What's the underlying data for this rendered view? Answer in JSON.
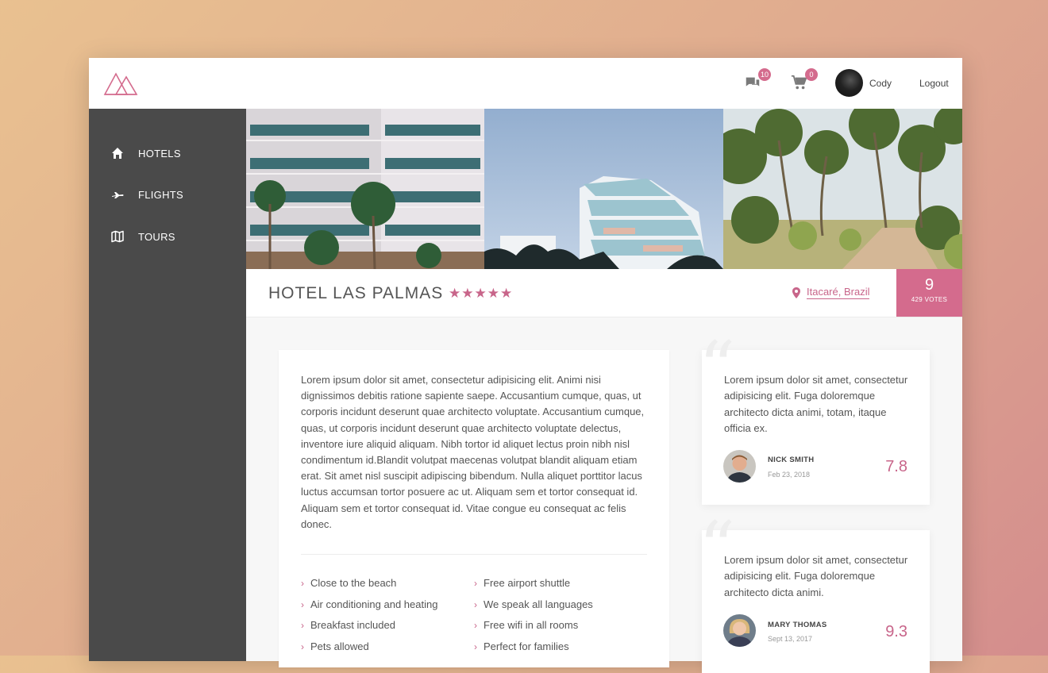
{
  "header": {
    "messages_badge": "10",
    "cart_badge": "0",
    "username": "Cody",
    "logout_label": "Logout"
  },
  "sidebar": {
    "items": [
      {
        "label": "HOTELS",
        "icon": "home-icon"
      },
      {
        "label": "FLIGHTS",
        "icon": "airplane-icon"
      },
      {
        "label": "TOURS",
        "icon": "map-icon"
      }
    ]
  },
  "hotel": {
    "title": "HOTEL LAS PALMAS",
    "stars": "★★★★★",
    "star_count": 5,
    "location": "Itacaré, Brazil",
    "score": "9",
    "votes": "429 VOTES"
  },
  "description": "Lorem ipsum dolor sit amet, consectetur adipisicing elit. Animi nisi dignissimos debitis ratione sapiente saepe. Accusantium cumque, quas, ut corporis incidunt deserunt quae architecto voluptate. Accusantium cumque, quas, ut corporis incidunt deserunt quae architecto voluptate delectus, inventore iure aliquid aliquam. Nibh tortor id aliquet lectus proin nibh nisl condimentum id.Blandit volutpat maecenas volutpat blandit aliquam etiam erat. Sit amet nisl suscipit adipiscing bibendum. Nulla aliquet porttitor lacus luctus accumsan tortor posuere ac ut. Aliquam sem et tortor consequat id. Aliquam sem et tortor consequat id. Vitae congue eu consequat ac felis donec.",
  "features": {
    "left": [
      "Close to the beach",
      "Air conditioning and heating",
      "Breakfast included",
      "Pets allowed"
    ],
    "right": [
      "Free airport shuttle",
      "We speak all languages",
      "Free wifi in all rooms",
      "Perfect for families"
    ]
  },
  "reviews": [
    {
      "text": "Lorem ipsum dolor sit amet, consectetur adipisicing elit. Fuga doloremque architecto dicta animi, totam, itaque officia ex.",
      "name": "NICK SMITH",
      "date": "Feb 23, 2018",
      "score": "7.8"
    },
    {
      "text": "Lorem ipsum dolor sit amet, consectetur adipisicing elit. Fuga doloremque architecto dicta animi.",
      "name": "MARY THOMAS",
      "date": "Sept 13, 2017",
      "score": "9.3"
    }
  ],
  "colors": {
    "accent": "#d46b8d",
    "sidebar": "#4a4a4a"
  }
}
